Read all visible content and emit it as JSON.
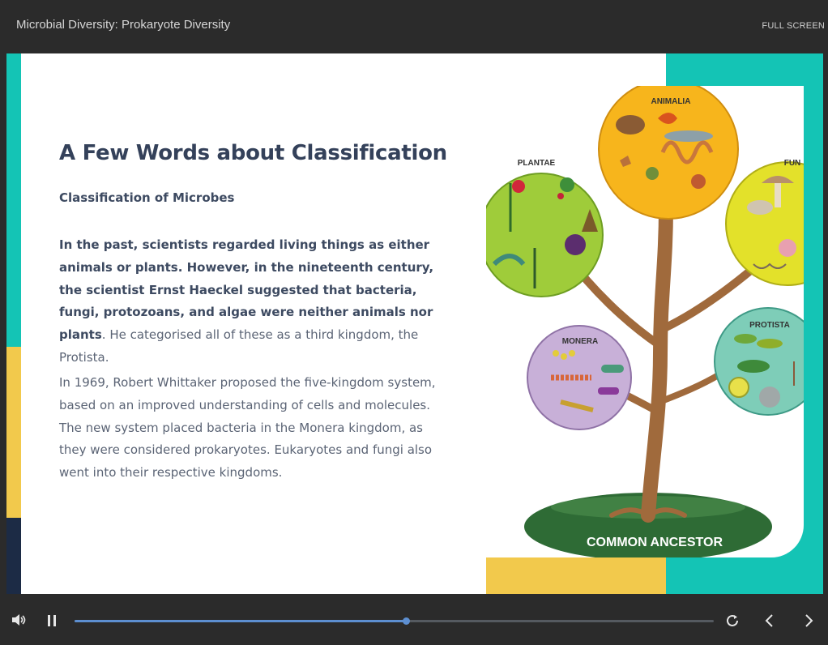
{
  "header": {
    "course_title": "Microbial Diversity: Prokaryote Diversity",
    "fullscreen_label": "FULL SCREEN"
  },
  "slide": {
    "heading": "A Few Words about Classification",
    "subheading": "Classification of Microbes",
    "paragraph1_bold": "In the past, scientists regarded living things as either animals or plants. However, in the nineteenth century, the scientist Ernst Haeckel suggested that bacteria, fungi, protozoans, and algae were neither animals nor plants",
    "paragraph1_rest": ". He categorised all of these as a third kingdom, the Protista.",
    "paragraph2": "In 1969, Robert Whittaker proposed the five-kingdom system, based on an improved understanding of cells and molecules. The new system placed bacteria in the Monera kingdom, as they were considered prokaryotes. Eukaryotes and fungi also went into their respective kingdoms."
  },
  "illustration": {
    "kingdoms": {
      "animalia": "ANIMALIA",
      "plantae": "PLANTAE",
      "fungi": "FUN",
      "monera": "MONERA",
      "protista": "PROTISTA"
    },
    "base_label": "COMMON ANCESTOR"
  },
  "controls": {
    "progress_fraction": 0.518,
    "icons": [
      "volume-icon",
      "pause-icon",
      "replay-icon",
      "chevron-left-icon",
      "chevron-right-icon"
    ]
  },
  "colors": {
    "teal": "#14c4b5",
    "yellow": "#f2c94c",
    "navy": "#1c2b45",
    "accent": "#5d8fd1"
  }
}
